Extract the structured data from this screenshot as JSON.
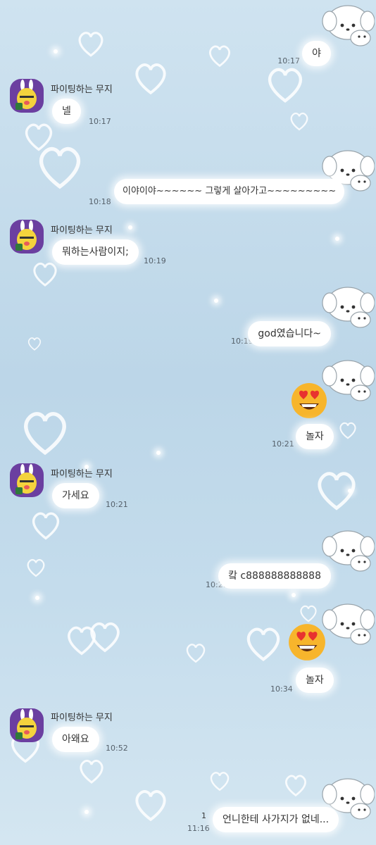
{
  "chat": {
    "other_name": "파이팅하는 무지",
    "messages": [
      {
        "text": "야",
        "time": "10:17"
      },
      {
        "text": "넬",
        "time": "10:17"
      },
      {
        "text": "이야이야~~~~~~ 그렇게 살아가고~~~~~~~~~",
        "time": "10:18"
      },
      {
        "text": "뭐하는사람이지;",
        "time": "10:19"
      },
      {
        "text": "god였습니다~",
        "time": "10:19"
      },
      {
        "text": "놀자",
        "time": "10:21"
      },
      {
        "text": "가세요",
        "time": "10:21"
      },
      {
        "text": "캌 c888888888888",
        "time": "10:21"
      },
      {
        "text": "놀자",
        "time": "10:34"
      },
      {
        "text": "아왜요",
        "time": "10:52"
      },
      {
        "text": "언니한테 사가지가 없네...",
        "time": "11:16",
        "unread": "1"
      }
    ]
  },
  "icons": {
    "my_profile": "white-puppy-icon",
    "other_profile": "muzi-character-icon",
    "emoticon": "heart-eyes-emoji-icon"
  },
  "colors": {
    "accent": "#6b3fa0",
    "bubble": "#ffffff"
  }
}
